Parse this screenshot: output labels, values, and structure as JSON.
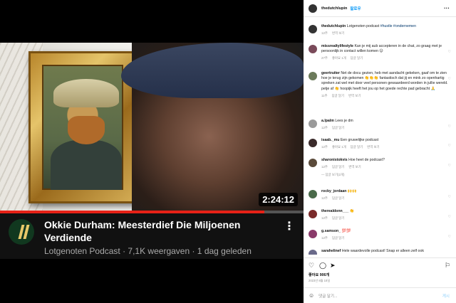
{
  "video": {
    "duration": "2:24:12",
    "progress_fraction": 0.87,
    "title": "Okkie Durham: Meesterdief Die Miljoenen Verdiende",
    "meta": "Lotgenoten Podcast · 7,1K weergaven · 1 dag geleden",
    "menu_icon": "⋮"
  },
  "post": {
    "username": "thedutchlupin",
    "follow_label": "팔로우",
    "more_icon": "···",
    "caption_user": "thedutchlupin",
    "caption_text": "Lotgenoten podcast ",
    "caption_tags": "#hustle #ondernemen",
    "caption_meta": {
      "time": "12주",
      "action": "번역 보기"
    }
  },
  "comments": [
    {
      "user": "missrealtylifestyle",
      "text": "Kan je mij aub accepteren in de chat, zo graag met je persoonlijk in contact willen komen 😊",
      "time": "27주",
      "likes": "좋아요 1개",
      "reply": "답글 달기",
      "avatar_color": "#7a4a5a"
    },
    {
      "user": "geertruiter",
      "text": "Net de docu gezien, heb met aandacht gekeken, gaaf om te zien hoe je terug zijn gekomen 👏👏👏 fantastisch dat jij en mink zo openhartig spreken zat wel met door veel personen gewaardeerd worden in jullie wereld. petje af 👏 hoopijk heeft het jou op het goede rechte pad gebracht 🙏",
      "time": "11주",
      "likes": "",
      "reply": "답글 달기",
      "extra": "번역 보기",
      "avatar_color": "#6b7a5a"
    },
    {
      "user": "a.lpalm",
      "text": "Lees je dm",
      "time": "12주",
      "likes": "",
      "reply": "답글 달기",
      "avatar_color": "#9a9a9a"
    },
    {
      "user": "isaab._mu",
      "text": "Een gruwelijke podcast",
      "time": "12주",
      "likes": "좋아요 1개",
      "reply": "답글 달기",
      "extra": "번역 보기",
      "avatar_color": "#3a2a2a"
    },
    {
      "user": "sharonistokvis",
      "text": "Hoe heet de podcast?",
      "time": "12주",
      "likes": "",
      "reply": "답글 달기",
      "extra": "번역 보기",
      "view_replies": "답글 보기(2개)",
      "avatar_color": "#5a4a3a"
    },
    {
      "user": "rocky_jordaan",
      "text": "🙌🙌",
      "time": "12주",
      "likes": "",
      "reply": "답글 달기",
      "avatar_color": "#4a6a4a"
    },
    {
      "user": "therealdonn___",
      "text": "👏",
      "time": "12주",
      "likes": "",
      "reply": "답글 달기",
      "avatar_color": "#7a2a2a"
    },
    {
      "user": "g.samson_",
      "text": "💯💯",
      "time": "12주",
      "likes": "",
      "reply": "답글 달기",
      "avatar_color": "#8a3a6a"
    },
    {
      "user": "sarahelinef",
      "text": "Hele waardevolle podcast! Snap er alleen zelf ook",
      "time": "",
      "likes": "",
      "reply": "",
      "avatar_color": "#6a6a8a"
    }
  ],
  "actions": {
    "like_icon": "heart-icon",
    "comment_icon": "comment-icon",
    "share_icon": "share-icon",
    "save_icon": "bookmark-icon",
    "likes": "좋아요 906개",
    "date": "2023년 8월 18일"
  },
  "add_comment": {
    "placeholder": "댓글 달기...",
    "post_label": "게시"
  }
}
